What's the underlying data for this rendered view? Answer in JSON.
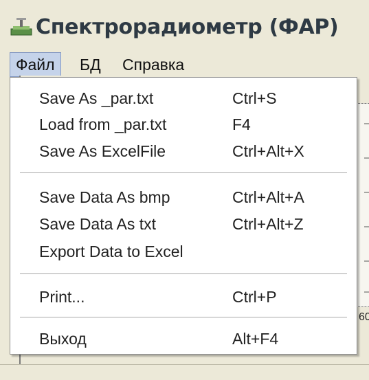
{
  "window": {
    "title": "Спектрорадиометр (ФАР)",
    "icon": "instrument-icon"
  },
  "menubar": {
    "items": [
      "Файл",
      "БД",
      "Справка"
    ],
    "active": "Файл"
  },
  "file_menu": {
    "items": [
      {
        "label": "Save As _par.txt",
        "shortcut": "Ctrl+S"
      },
      {
        "label": "Load from _par.txt",
        "shortcut": "F4"
      },
      {
        "label": "Save As ExcelFile",
        "shortcut": "Ctrl+Alt+X"
      },
      {
        "label": "Save Data As bmp",
        "shortcut": "Ctrl+Alt+A"
      },
      {
        "label": "Save Data As txt",
        "shortcut": "Ctrl+Alt+Z"
      },
      {
        "label": "Export Data to Excel",
        "shortcut": ""
      },
      {
        "label": "Print...",
        "shortcut": "Ctrl+P"
      },
      {
        "label": "Выход",
        "shortcut": "Alt+F4"
      }
    ]
  },
  "background": {
    "axis_label": "60"
  },
  "colors": {
    "menu_highlight": "#c5d3ea",
    "menu_bg": "#ffffff",
    "window_bg": "#ece9d8"
  }
}
